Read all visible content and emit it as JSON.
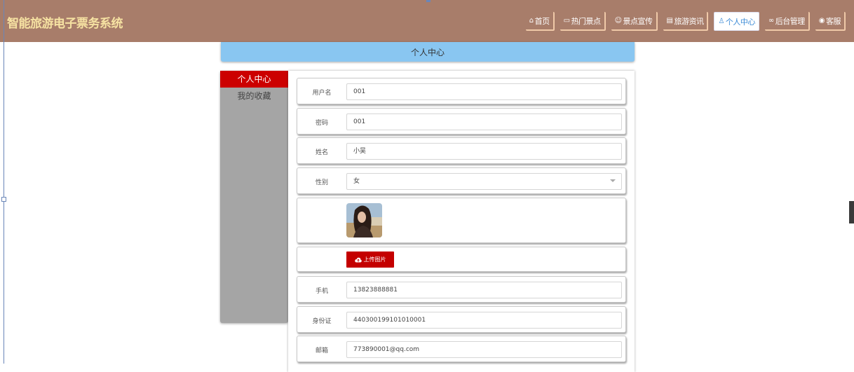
{
  "header": {
    "title": "智能旅游电子票务系统",
    "nav": [
      {
        "icon": "home-icon",
        "glyph": "⌂",
        "label": "首页"
      },
      {
        "icon": "ticket-icon",
        "glyph": "▭",
        "label": "热门景点"
      },
      {
        "icon": "smile-icon",
        "glyph": "☺",
        "label": "景点宣传"
      },
      {
        "icon": "news-icon",
        "glyph": "▤",
        "label": "旅游资讯"
      },
      {
        "icon": "user-icon",
        "glyph": "♙",
        "label": "个人中心"
      },
      {
        "icon": "link-icon",
        "glyph": "∞",
        "label": "后台管理"
      },
      {
        "icon": "support-icon",
        "glyph": "◉",
        "label": "客服"
      }
    ],
    "active_nav": "个人中心"
  },
  "banner": {
    "title": "个人中心"
  },
  "sidebar": {
    "items": [
      {
        "label": "个人中心"
      },
      {
        "label": "我的收藏"
      }
    ]
  },
  "form": {
    "username": {
      "label": "用户名",
      "value": "001"
    },
    "password": {
      "label": "密码",
      "value": "001"
    },
    "name": {
      "label": "姓名",
      "value": "小吴"
    },
    "gender": {
      "label": "性别",
      "value": "女"
    },
    "upload_label": "上传图片",
    "phone": {
      "label": "手机",
      "value": "13823888881"
    },
    "id_card": {
      "label": "身份证",
      "value": "440300199101010001"
    },
    "email": {
      "label": "邮箱",
      "value": "773890001@qq.com"
    }
  },
  "colors": {
    "header_bg": "#a87d6a",
    "title": "#f6e2a2",
    "accent_red": "#cc0000",
    "banner": "#89c6f1",
    "sidebar": "#a5a5a5"
  }
}
